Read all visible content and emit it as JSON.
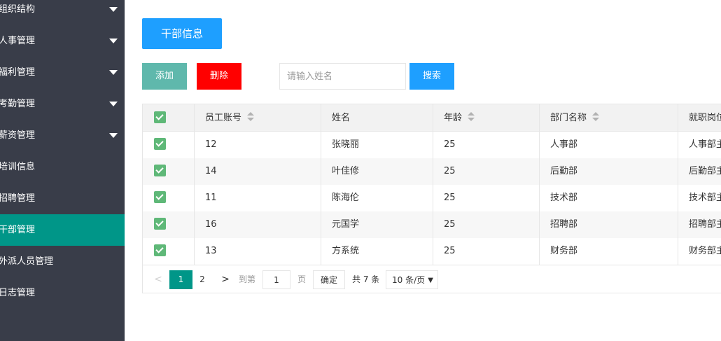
{
  "sidebar": {
    "items": [
      {
        "label": "组织结构",
        "has_caret": true
      },
      {
        "label": "人事管理",
        "has_caret": true
      },
      {
        "label": "福利管理",
        "has_caret": true
      },
      {
        "label": "考勤管理",
        "has_caret": true
      },
      {
        "label": "薪资管理",
        "has_caret": true
      },
      {
        "label": "培训信息",
        "has_caret": false
      },
      {
        "label": "招聘管理",
        "has_caret": false
      },
      {
        "label": "干部管理",
        "has_caret": false,
        "active": true
      },
      {
        "label": "外派人员管理",
        "has_caret": false
      },
      {
        "label": "日志管理",
        "has_caret": false
      }
    ]
  },
  "main": {
    "title_button": "干部信息",
    "add_button": "添加",
    "delete_button": "删除",
    "search": {
      "placeholder": "请输入姓名",
      "value": ""
    },
    "search_button": "搜索"
  },
  "table": {
    "headers": [
      "员工账号",
      "姓名",
      "年龄",
      "部门名称",
      "就职岗位"
    ],
    "rows": [
      [
        "12",
        "张晓丽",
        "25",
        "人事部",
        "人事部主管"
      ],
      [
        "14",
        "叶佳修",
        "25",
        "后勤部",
        "后勤部主管"
      ],
      [
        "11",
        "陈海伦",
        "25",
        "技术部",
        "技术部主管"
      ],
      [
        "16",
        "元国学",
        "25",
        "招聘部",
        "招聘部主管"
      ],
      [
        "13",
        "方系统",
        "25",
        "财务部",
        "财务部主管"
      ]
    ]
  },
  "pager": {
    "prev": "<",
    "current_page": "1",
    "page_2": "2",
    "next": ">",
    "goto_label": "到第",
    "goto_value": "1",
    "page_label": "页",
    "confirm": "确定",
    "total": "共 7 条",
    "page_size": "10 条/页"
  },
  "colors": {
    "sidebar_bg": "#393d49",
    "active_bg": "#009688",
    "primary_blue": "#1e9fff",
    "add_green": "#5fb8ac",
    "delete_red": "#ff0000",
    "checkbox_green": "#5fb878"
  }
}
